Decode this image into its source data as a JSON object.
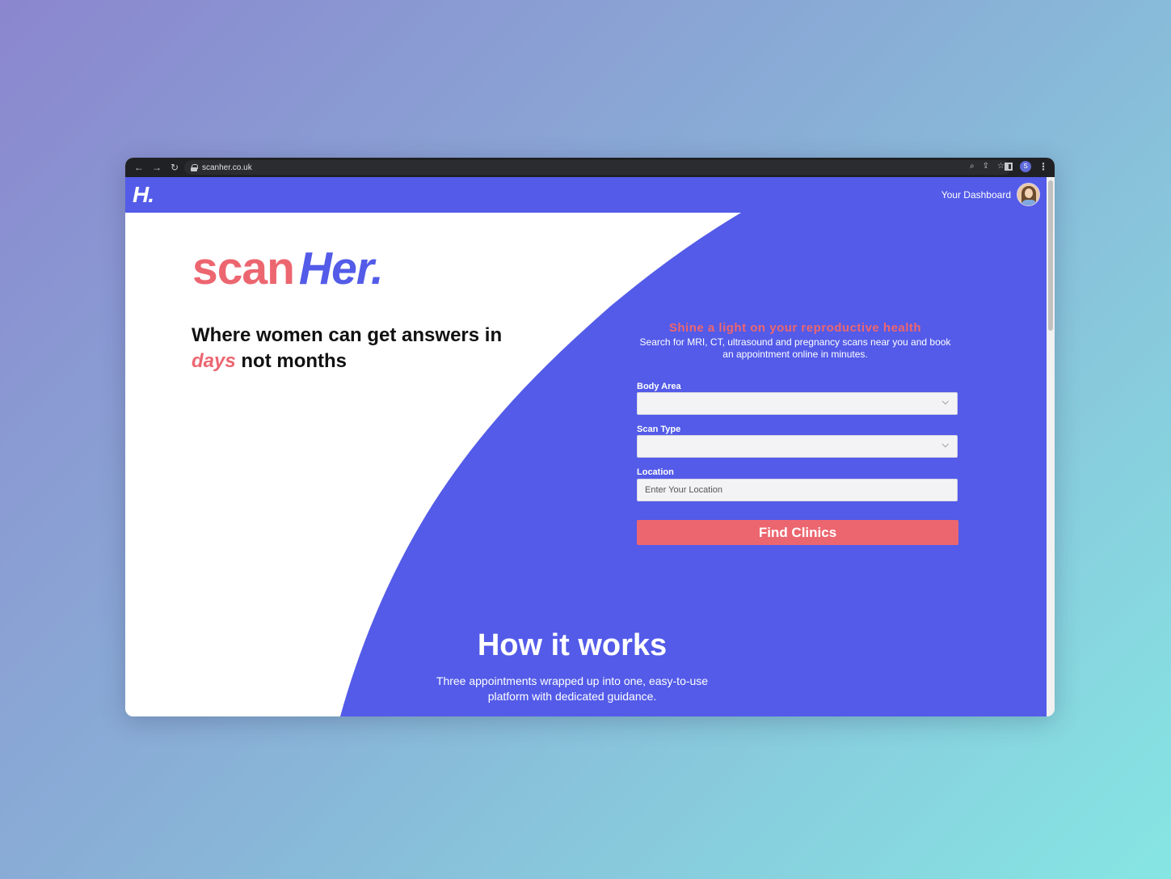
{
  "browser": {
    "url": "scanher.co.uk",
    "back_icon": "arrow-left-icon",
    "forward_icon": "arrow-right-icon",
    "reload_icon": "reload-icon",
    "profile_initial": "S"
  },
  "header": {
    "logo": "H.",
    "dashboard_label": "Your Dashboard"
  },
  "hero": {
    "brand_scan": "scan",
    "brand_her": "Her.",
    "tagline_part1": "Where women can get answers in",
    "tagline_highlight": "days",
    "tagline_part2": "not months"
  },
  "search": {
    "heading": "Shine a light on your reproductive health",
    "description": "Search for MRI, CT, ultrasound and pregnancy scans near you and book an appointment online in minutes.",
    "body_area_label": "Body Area",
    "body_area_value": "",
    "scan_type_label": "Scan Type",
    "scan_type_value": "",
    "location_label": "Location",
    "location_placeholder": "Enter Your Location",
    "submit_label": "Find Clinics"
  },
  "how": {
    "title": "How it works",
    "subtitle": "Three appointments wrapped up into one, easy-to-use platform with dedicated guidance."
  },
  "colors": {
    "brand_blue": "#535be8",
    "brand_pink": "#ec6670",
    "white": "#ffffff"
  }
}
